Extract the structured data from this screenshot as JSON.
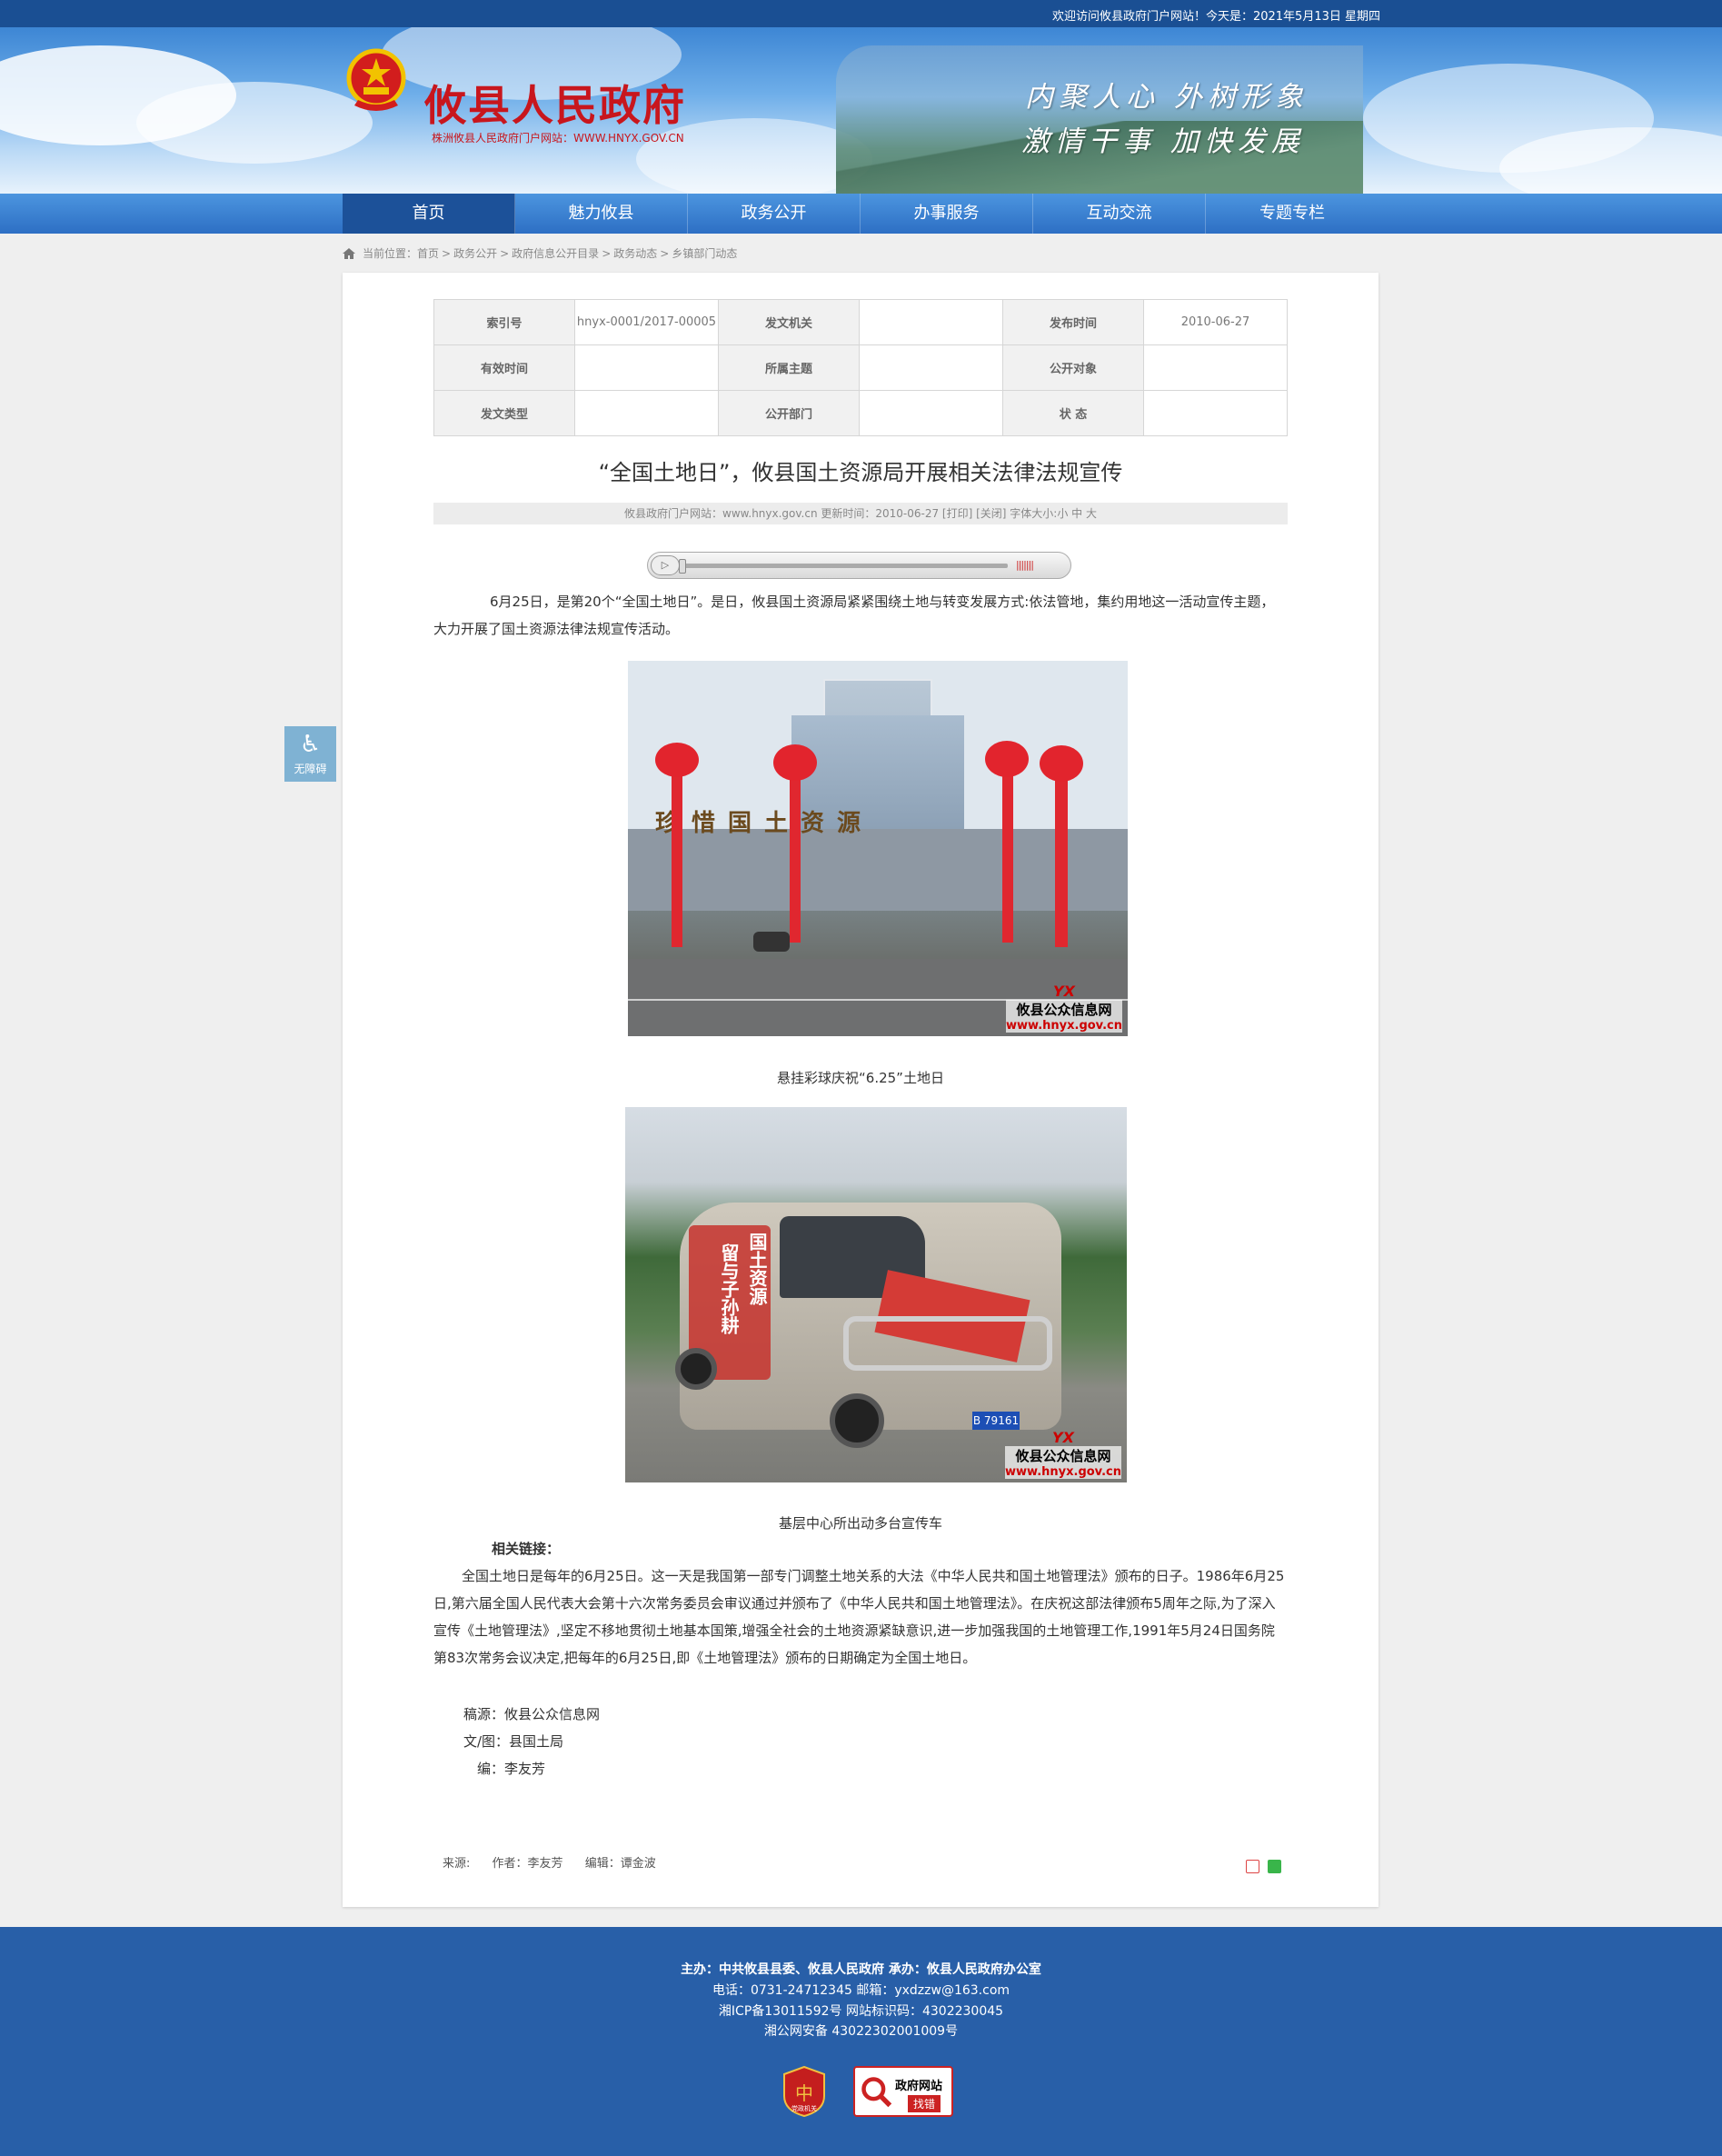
{
  "topbar": {
    "welcome": "欢迎访问攸县政府门户网站！今天是：2021年5月13日 星期四"
  },
  "header": {
    "emblem_icon": "national-emblem-icon",
    "site_title": "攸县人民政府",
    "site_url": "株洲攸县人民政府门户网站：WWW.HNYX.GOV.CN",
    "slogan_line1": "内聚人心 外树形象",
    "slogan_line2": "激情干事 加快发展"
  },
  "nav": {
    "items": [
      {
        "label": "首页",
        "active": true
      },
      {
        "label": "魅力攸县"
      },
      {
        "label": "政务公开"
      },
      {
        "label": "办事服务"
      },
      {
        "label": "互动交流"
      },
      {
        "label": "专题专栏"
      }
    ]
  },
  "breadcrumb": {
    "prefix": "当前位置：",
    "items": [
      "首页",
      "政务公开",
      "政府信息公开目录",
      "政务动态",
      "乡镇部门动态"
    ],
    "separator": ">"
  },
  "accessibility": {
    "label": "无障碍",
    "icon": "wheelchair-icon"
  },
  "meta_table": {
    "row1": {
      "k1": "索引号",
      "v1": "hnyx-0001/2017-00005",
      "k2": "发文机关",
      "v2": "",
      "k3": "发布时间",
      "v3": "2010-06-27"
    },
    "row2": {
      "k1": "有效时间",
      "v1": "",
      "k2": "所属主题",
      "v2": "",
      "k3": "公开对象",
      "v3": ""
    },
    "row3": {
      "k1": "发文类型",
      "v1": "",
      "k2": "公开部门",
      "v2": "",
      "k3": "状 态",
      "v3": ""
    }
  },
  "article": {
    "title": "“全国土地日”，攸县国土资源局开展相关法律法规宣传",
    "info_bar": "攸县政府门户网站：www.hnyx.gov.cn   更新时间：2010-06-27  [打印] [关闭]  字体大小:小 中 大",
    "para1": "6月25日，是第20个“全国土地日”。是日，攸县国土资源局紧紧围绕土地与转变发展方式:依法管地，集约用地这一活动宣传主题，大力开展了国土资源法律法规宣传活动。",
    "photo1": {
      "caption": "悬挂彩球庆祝“6.25”土地日",
      "sign_text": "珍惜国土资源",
      "wm_logo": "YX",
      "wm_name": "攸县公众信息网",
      "wm_url": "www.hnyx.gov.cn"
    },
    "photo2": {
      "caption": "基层中心所出动多台宣传车",
      "van_text1": "国土资源",
      "van_text2": "留与子孙耕",
      "plate": "B 79161",
      "wm_logo": "YX",
      "wm_name": "攸县公众信息网",
      "wm_url": "www.hnyx.gov.cn"
    },
    "related_heading": "相关链接：",
    "related_para": "全国土地日是每年的6月25日。这一天是我国第一部专门调整土地关系的大法《中华人民共和国土地管理法》颁布的日子。1986年6月25日,第六届全国人民代表大会第十六次常务委员会审议通过并颁布了《中华人民共和国土地管理法》。在庆祝这部法律颁布5周年之际,为了深入宣传《土地管理法》,坚定不移地贯彻土地基本国策,增强全社会的土地资源紧缺意识,进一步加强我国的土地管理工作,1991年5月24日国务院第83次常务会议决定,把每年的6月25日,即《土地管理法》颁布的日期确定为全国土地日。",
    "credits": {
      "source": "稿源：攸县公众信息网",
      "author": "文/图：县国土局",
      "editor": "编：李友芳"
    },
    "bottom": {
      "source": "来源:",
      "author": "作者：李友芳",
      "editor": "编辑：谭金波"
    }
  },
  "footer": {
    "line1": "主办：中共攸县县委、攸县人民政府 承办：攸县人民政府办公室",
    "line2": "电话：0731-24712345 邮箱：yxdzzw@163.com",
    "line3": "湘ICP备13011592号    网站标识码：4302230045",
    "line4": "湘公网安备 43022302001009号",
    "badge1_label": "党政机关",
    "badge2_label": "政府网站",
    "badge2_sub": "找错"
  },
  "colors": {
    "brand_blue": "#1a4f93",
    "nav_blue": "#2d6fc4",
    "title_red": "#c8161d",
    "footer_blue": "#285fa8"
  }
}
